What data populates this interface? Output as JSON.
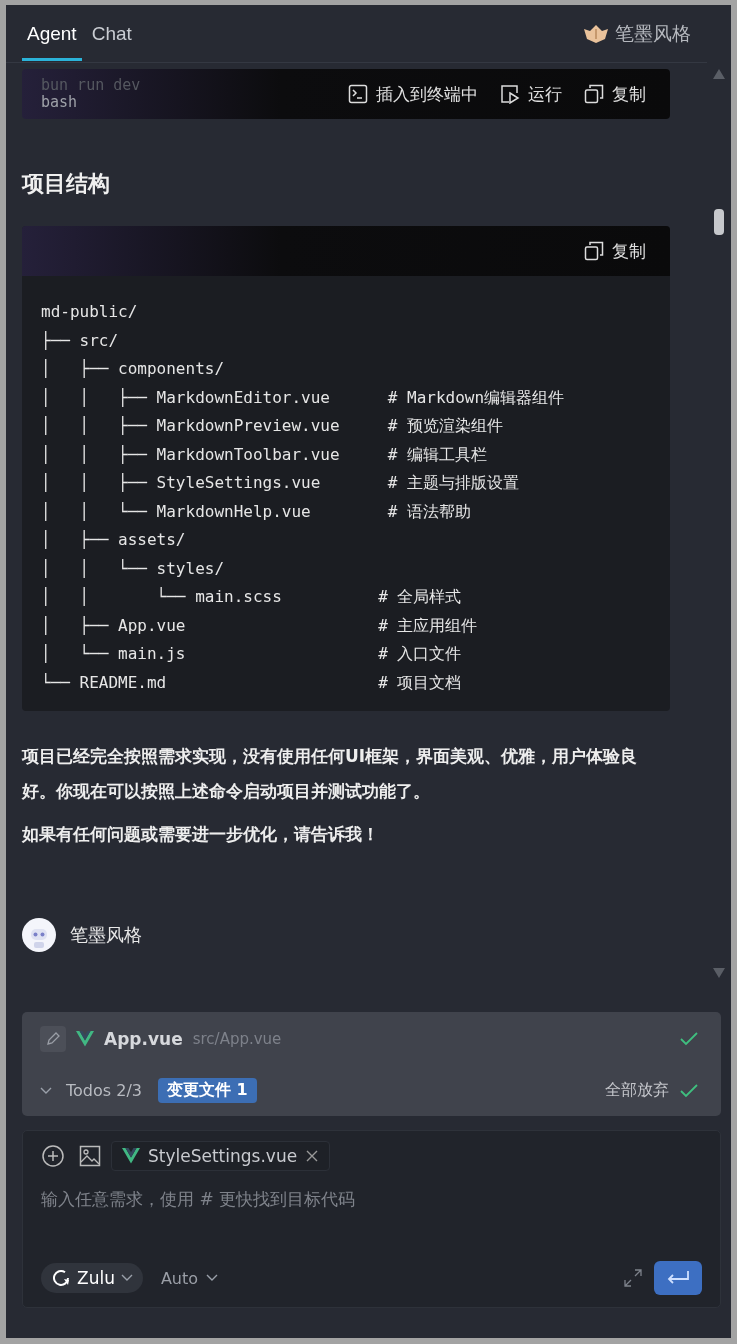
{
  "tabs": [
    {
      "label": "Agent",
      "selected": true
    },
    {
      "label": "Chat",
      "selected": false
    }
  ],
  "brand": "笔墨风格",
  "first_block": {
    "faded_code": "bun run dev",
    "language": "bash",
    "actions": [
      {
        "kind": "terminal",
        "label": "插入到终端中"
      },
      {
        "kind": "run",
        "label": "运行"
      },
      {
        "kind": "copy",
        "label": "复制"
      }
    ]
  },
  "heading": "项目结构",
  "second_block": {
    "actions": [
      {
        "kind": "copy",
        "label": "复制"
      }
    ],
    "lines": [
      "md-public/",
      "├── src/",
      "│   ├── components/",
      "│   │   ├── MarkdownEditor.vue      # Markdown编辑器组件",
      "│   │   ├── MarkdownPreview.vue     # 预览渲染组件",
      "│   │   ├── MarkdownToolbar.vue     # 编辑工具栏",
      "│   │   ├── StyleSettings.vue       # 主题与排版设置",
      "│   │   └── MarkdownHelp.vue        # 语法帮助",
      "│   ├── assets/",
      "│   │   └── styles/",
      "│   │       └── main.scss          # 全局样式",
      "│   ├── App.vue                    # 主应用组件",
      "│   └── main.js                    # 入口文件",
      "└── README.md                      # 项目文档"
    ]
  },
  "paragraphs": [
    "项目已经完全按照需求实现，没有使用任何UI框架，界面美观、优雅，用户体验良好。你现在可以按照上述命令启动项目并测试功能了。",
    "如果有任何问题或需要进一步优化，请告诉我！"
  ],
  "assistant": {
    "name": "笔墨风格"
  },
  "changes": {
    "file": {
      "name": "App.vue",
      "path": "src/App.vue",
      "accepted": true
    },
    "todos": "Todos 2/3",
    "badge": "变更文件 1",
    "discard_all": "全部放弃"
  },
  "composer": {
    "attachment": "StyleSettings.vue",
    "placeholder": "输入任意需求，使用 # 更快找到目标代码",
    "model": "Zulu",
    "mode": "Auto"
  }
}
